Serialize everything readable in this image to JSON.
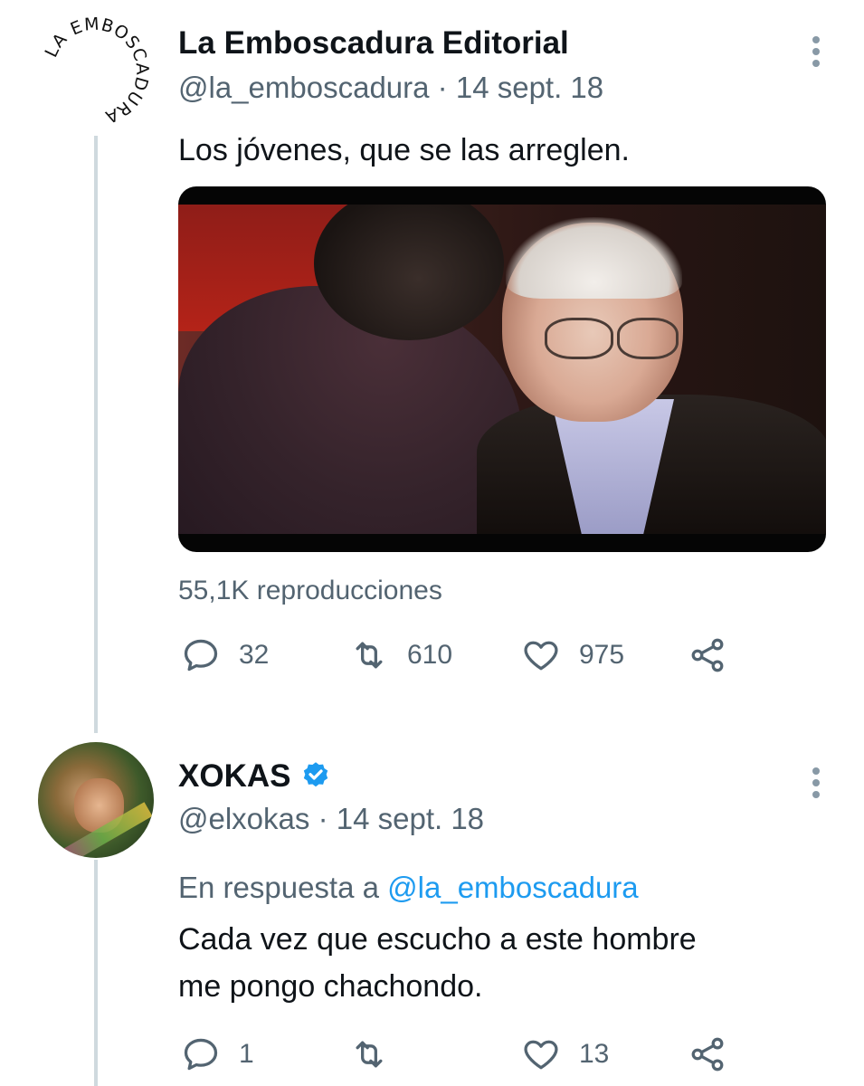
{
  "tweet1": {
    "logo_text": "LA EMBOSCADURA",
    "author_name": "La Emboscadura Editorial",
    "handle": "@la_emboscadura",
    "separator": "·",
    "date": "14 sept. 18",
    "text": "Los jóvenes, que se las arreglen.",
    "views": "55,1K reproducciones",
    "actions": {
      "replies": "32",
      "retweets": "610",
      "likes": "975"
    }
  },
  "tweet2": {
    "author_name": "XOKAS",
    "handle": "@elxokas",
    "separator": "·",
    "date": "14 sept. 18",
    "reply_prefix": "En respuesta a",
    "reply_to": "@la_emboscadura",
    "text_line1": "Cada vez que escucho a este hombre",
    "text_line2": "me pongo chachondo.",
    "actions": {
      "replies": "1",
      "retweets": "",
      "likes": "13"
    }
  },
  "colors": {
    "text": "#0f1419",
    "muted": "#536471",
    "link": "#1d9bf0",
    "thread_line": "#cfd9de"
  }
}
